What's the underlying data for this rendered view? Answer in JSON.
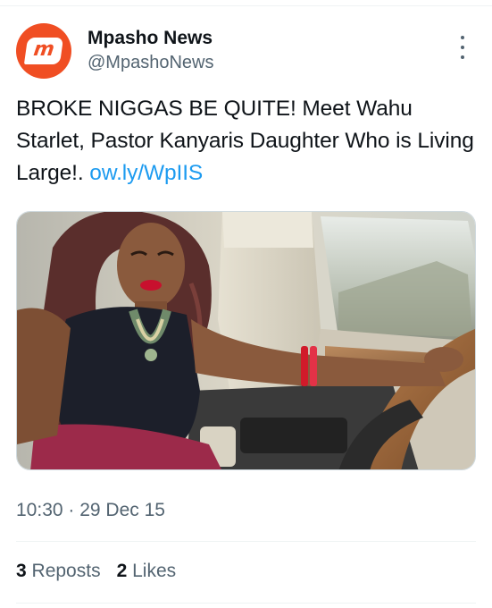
{
  "author": {
    "display_name": "Mpasho News",
    "handle": "@MpashoNews",
    "avatar_letter": "m",
    "avatar_color": "#f04e23"
  },
  "tweet": {
    "text": "BROKE NIGGAS BE QUITE! Meet Wahu Starlet, Pastor Kanyaris Daughter Who is Living Large!. ",
    "link": "ow.ly/WpIIS",
    "timestamp": "10:30 · 29 Dec 15"
  },
  "stats": {
    "reposts_count": "3",
    "reposts_label": "Reposts",
    "likes_count": "2",
    "likes_label": "Likes"
  },
  "icons": {
    "more": "more-options-icon"
  },
  "colors": {
    "link": "#1d9bf0",
    "secondary_text": "#536471",
    "primary_text": "#0f1419"
  }
}
